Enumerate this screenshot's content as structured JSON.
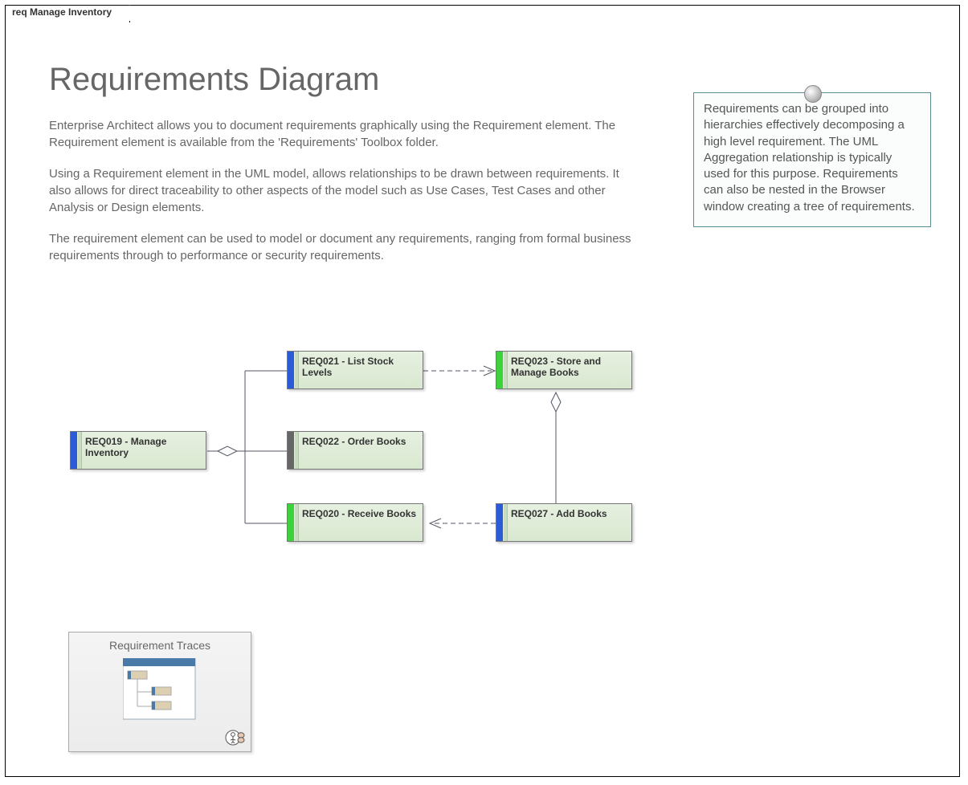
{
  "frame": {
    "tab_label": "req Manage Inventory"
  },
  "header": {
    "title": "Requirements Diagram",
    "p1": "Enterprise Architect allows you to document requirements graphically using the Requirement element. The Requirement element is available from the 'Requirements' Toolbox folder.",
    "p2": "Using a Requirement element in the UML model, allows relationships to be drawn between requirements. It also allows for direct traceability to other aspects of the model such as Use Cases, Test Cases and other Analysis or Design elements.",
    "p3": "The requirement element can be used to model or document any requirements, ranging from formal business requirements through to performance or security requirements."
  },
  "note": {
    "text": "Requirements can be grouped into hierarchies effectively decomposing a high level requirement. The UML Aggregation relationship is typically used for this purpose. Requirements can also be nested in the Browser window creating a tree of requirements."
  },
  "requirements": {
    "req019": {
      "label": "REQ019 - Manage Inventory",
      "stripe": "#2b5bd7"
    },
    "req021": {
      "label": "REQ021 - List Stock Levels",
      "stripe": "#2b5bd7"
    },
    "req022": {
      "label": "REQ022 - Order Books",
      "stripe": "#666666"
    },
    "req020": {
      "label": "REQ020 - Receive Books",
      "stripe": "#3bd23b"
    },
    "req023": {
      "label": "REQ023 - Store and Manage Books",
      "stripe": "#3bd23b"
    },
    "req027": {
      "label": "REQ027 - Add Books",
      "stripe": "#2b5bd7"
    }
  },
  "navcell": {
    "title": "Requirement Traces"
  },
  "chart_data": {
    "type": "diagram",
    "title": "Requirements Diagram — req Manage Inventory",
    "nodes": [
      {
        "id": "REQ019",
        "label": "REQ019 - Manage Inventory",
        "status_color": "blue"
      },
      {
        "id": "REQ021",
        "label": "REQ021 - List Stock Levels",
        "status_color": "blue"
      },
      {
        "id": "REQ022",
        "label": "REQ022 - Order Books",
        "status_color": "grey"
      },
      {
        "id": "REQ020",
        "label": "REQ020 - Receive Books",
        "status_color": "green"
      },
      {
        "id": "REQ023",
        "label": "REQ023 - Store and Manage Books",
        "status_color": "green"
      },
      {
        "id": "REQ027",
        "label": "REQ027 - Add Books",
        "status_color": "blue"
      }
    ],
    "edges": [
      {
        "from": "REQ021",
        "to": "REQ019",
        "type": "aggregation",
        "style": "solid"
      },
      {
        "from": "REQ022",
        "to": "REQ019",
        "type": "aggregation",
        "style": "solid"
      },
      {
        "from": "REQ020",
        "to": "REQ019",
        "type": "aggregation",
        "style": "solid"
      },
      {
        "from": "REQ027",
        "to": "REQ023",
        "type": "aggregation",
        "style": "solid"
      },
      {
        "from": "REQ021",
        "to": "REQ023",
        "type": "dependency",
        "style": "dashed"
      },
      {
        "from": "REQ027",
        "to": "REQ020",
        "type": "dependency",
        "style": "dashed"
      }
    ],
    "linked_diagrams": [
      {
        "name": "Requirement Traces"
      }
    ]
  }
}
